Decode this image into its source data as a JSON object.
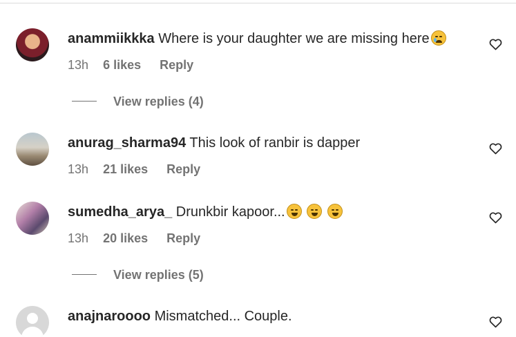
{
  "comments": [
    {
      "username": "anammiikkka",
      "text": "Where is your daughter we are missing here",
      "emojis": [
        "sad-tear-emoji"
      ],
      "time": "13h",
      "likes": "6 likes",
      "reply": "Reply",
      "view_replies": "View replies (4)"
    },
    {
      "username": "anurag_sharma94",
      "text": "This look of ranbir is dapper",
      "emojis": [],
      "time": "13h",
      "likes": "21 likes",
      "reply": "Reply",
      "view_replies": ""
    },
    {
      "username": "sumedha_arya_",
      "text": "Drunkbir kapoor...",
      "emojis": [
        "laughing-tears-emoji",
        "laughing-tears-emoji",
        "laughing-tears-emoji"
      ],
      "time": "13h",
      "likes": "20 likes",
      "reply": "Reply",
      "view_replies": "View replies (5)"
    },
    {
      "username": "anajnaroooo",
      "text": "Mismatched... Couple.",
      "emojis": [],
      "time": "",
      "likes": "",
      "reply": "",
      "view_replies": ""
    }
  ],
  "icons": {
    "like": "heart-outline-icon",
    "default_avatar": "default-avatar-icon"
  },
  "colors": {
    "text": "#262626",
    "secondary": "#737373",
    "divider": "#dbdbdb"
  }
}
